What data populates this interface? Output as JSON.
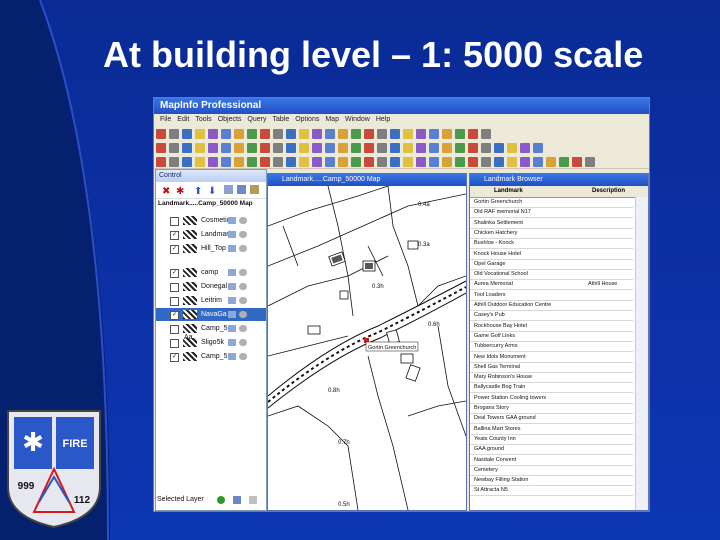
{
  "slide": {
    "title": "At building level – 1: 5000 scale",
    "colors": {
      "background": "#0b2f9c",
      "accent": "#3169c6"
    }
  },
  "app": {
    "window_title": "MapInfo Professional",
    "menu": [
      "File",
      "Edit",
      "Tools",
      "Objects",
      "Query",
      "Table",
      "Options",
      "Map",
      "Window",
      "Help"
    ]
  },
  "control_panel": {
    "title": "Control",
    "map_label": "Landmark.....Camp_50000 Map",
    "layers": [
      {
        "name": "Cosmetic",
        "checked": false,
        "selected": false
      },
      {
        "name": "Landmarks",
        "checked": true,
        "selected": false
      },
      {
        "name": "Hill_Top",
        "checked": true,
        "selected": false
      },
      {
        "name": "camp",
        "checked": true,
        "selected": false
      },
      {
        "name": "Donegal",
        "checked": false,
        "selected": false
      },
      {
        "name": "Leitrim",
        "checked": false,
        "selected": false
      },
      {
        "name": "NavaGa",
        "checked": true,
        "selected": true
      },
      {
        "name": "Camp_5",
        "checked": false,
        "selected": false
      },
      {
        "name": "Sligo5k",
        "checked": false,
        "selected": false
      },
      {
        "name": "Camp_5",
        "checked": true,
        "selected": false
      }
    ],
    "status": "Selected Layer"
  },
  "map_window": {
    "title": "Landmark.....Camp_50000 Map",
    "labels": [
      "0.4a",
      "0.3a",
      "0.3h",
      "0.8h",
      "0.7h",
      "0.6h",
      "0.5h"
    ],
    "callout": "Gortin Greenchurch"
  },
  "landmark_browser": {
    "title": "Landmark Browser",
    "columns": [
      "Landmark",
      "Description"
    ],
    "rows": [
      {
        "landmark": "Gortin Greenchurch",
        "desc": ""
      },
      {
        "landmark": "Old RAF memorial N17",
        "desc": ""
      },
      {
        "landmark": "Shalinka Settlement",
        "desc": ""
      },
      {
        "landmark": "Chicken Hatchery",
        "desc": ""
      },
      {
        "landmark": "Bushloe - Knock",
        "desc": ""
      },
      {
        "landmark": "Knock House Hotel",
        "desc": ""
      },
      {
        "landmark": "Opel Garage",
        "desc": ""
      },
      {
        "landmark": "Old Vocational School",
        "desc": ""
      },
      {
        "landmark": "Aurea Memorial",
        "desc": "Athill House"
      },
      {
        "landmark": "Tool Loaders",
        "desc": ""
      },
      {
        "landmark": "Athill Outdoor Education Centre",
        "desc": ""
      },
      {
        "landmark": "Casey's Pub",
        "desc": ""
      },
      {
        "landmark": "Rockhouse Bay Hotel",
        "desc": ""
      },
      {
        "landmark": "Game Golf Links",
        "desc": ""
      },
      {
        "landmark": "Tubbercurry Arms",
        "desc": ""
      },
      {
        "landmark": "New Idols Monument",
        "desc": ""
      },
      {
        "landmark": "Shell Gas Terminal",
        "desc": ""
      },
      {
        "landmark": "Mary Robinson's House",
        "desc": ""
      },
      {
        "landmark": "Ballycastle Bog Train",
        "desc": ""
      },
      {
        "landmark": "Power Station Cooling towers",
        "desc": ""
      },
      {
        "landmark": "Brogans Story",
        "desc": ""
      },
      {
        "landmark": "Deal Towers GAA ground",
        "desc": ""
      },
      {
        "landmark": "Ballina Mart Stores",
        "desc": ""
      },
      {
        "landmark": "Yeats County Inn",
        "desc": ""
      },
      {
        "landmark": "GAA ground",
        "desc": ""
      },
      {
        "landmark": "Nasdale Convent",
        "desc": ""
      },
      {
        "landmark": "Cemetery",
        "desc": ""
      },
      {
        "landmark": "Newbay Filling Station",
        "desc": ""
      },
      {
        "landmark": "St Attracta N5",
        "desc": ""
      }
    ]
  },
  "logo": {
    "badge_text": "FIRE",
    "numbers": [
      "999",
      "112"
    ]
  }
}
